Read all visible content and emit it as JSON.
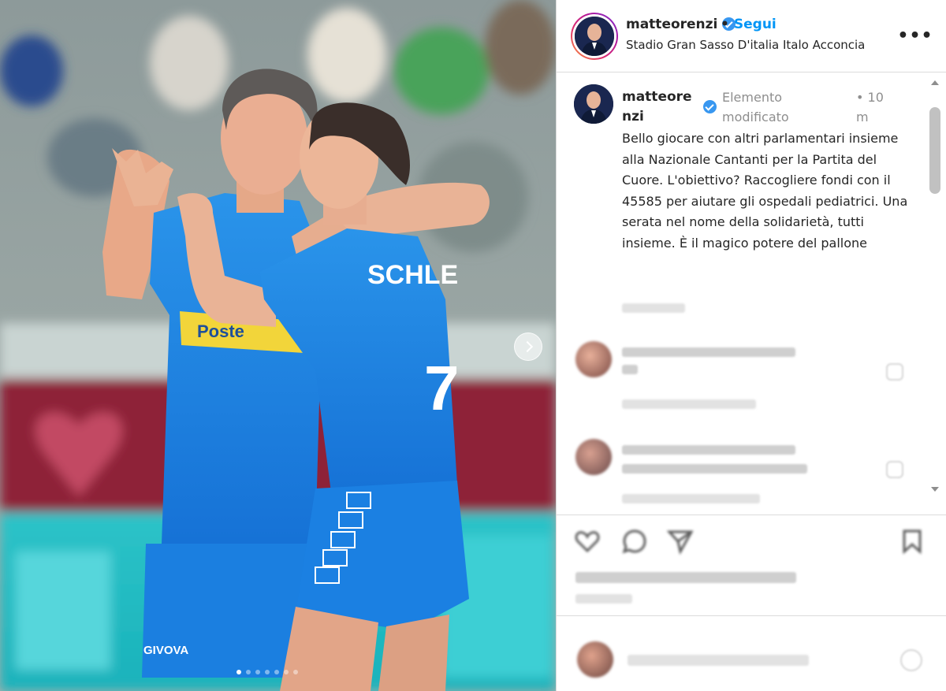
{
  "photo": {
    "jersey_text_left": "SCHLE",
    "jersey_number": "7",
    "sponsor": "Poste",
    "kit_brand": "GIVOVA",
    "carousel_dots": 7,
    "carousel_active_index": 0
  },
  "header": {
    "username": "matteorenzi",
    "separator": "•",
    "follow_label": "Segui",
    "location": "Stadio Gran Sasso D'italia Italo Acconcia",
    "more_label": "•••"
  },
  "caption": {
    "username": "matteorenzi",
    "edited_label": "Elemento modificato",
    "separator": "•",
    "time": "10 m",
    "text": "Bello giocare con altri parlamentari insieme alla Nazionale Cantanti per la Partita del Cuore. L'obiettivo? Raccogliere fondi con il 45585 per aiutare gli ospedali pediatrici. Una serata nel nome della solidarietà, tutti insieme. È il magico potere del pallone"
  },
  "colors": {
    "accent_blue": "#0095f6",
    "verified_blue": "#3897f0",
    "muted_text": "#8e8e8e",
    "jersey_blue": "#1e8be8"
  },
  "icons": [
    "verified-icon",
    "more-options-icon",
    "chevron-right-icon",
    "heart-icon",
    "comment-icon",
    "share-icon",
    "bookmark-icon",
    "emoji-icon"
  ]
}
